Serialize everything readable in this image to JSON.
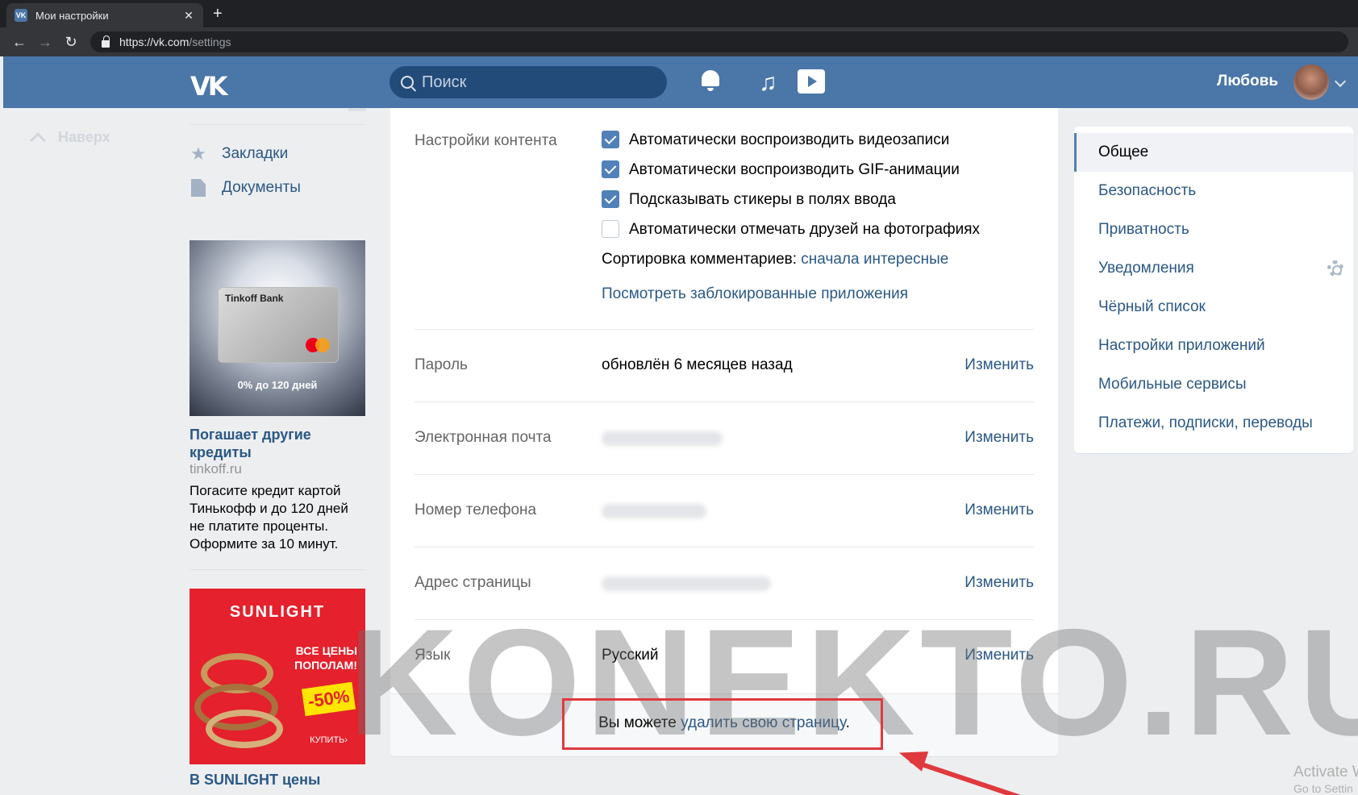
{
  "browser": {
    "tab_title": "Мои настройки",
    "tab_favicon": "VK",
    "url_host": "https://vk.com",
    "url_path": "/settings"
  },
  "header": {
    "logo": "VK",
    "search_placeholder": "Поиск",
    "username": "Любовь"
  },
  "left": {
    "up_button": "Наверх",
    "nav": [
      {
        "label": "Закладки",
        "icon": "star-icon"
      },
      {
        "label": "Документы",
        "icon": "document-icon"
      }
    ],
    "ads": [
      {
        "image_brand": "Tinkoff Bank",
        "image_caption": "0% до 120 дней",
        "title": "Погашает другие кредиты",
        "domain": "tinkoff.ru",
        "text": "Погасите кредит картой Тинькофф и до 120 дней не платите проценты. Оформите за 10 минут."
      },
      {
        "image_brand": "SUNLIGHT",
        "image_line1": "ВСЕ ЦЕНЫ",
        "image_line2": "ПОПОЛАМ!",
        "image_badge": "-50%",
        "image_buy": "КУПИТЬ›",
        "title": "В SUNLIGHT цены"
      }
    ]
  },
  "settings": {
    "content_label": "Настройки контента",
    "content_options": [
      {
        "label": "Автоматически воспроизводить видеозаписи",
        "checked": true
      },
      {
        "label": "Автоматически воспроизводить GIF-анимации",
        "checked": true
      },
      {
        "label": "Подсказывать стикеры в полях ввода",
        "checked": true
      },
      {
        "label": "Автоматически отмечать друзей на фотографиях",
        "checked": false
      }
    ],
    "sort_label": "Сортировка комментариев:",
    "sort_value": "сначала интересные",
    "blocked_apps_link": "Посмотреть заблокированные приложения",
    "change_label": "Изменить",
    "rows": [
      {
        "label": "Пароль",
        "value": "обновлён 6 месяцев назад"
      },
      {
        "label": "Электронная почта",
        "value": ""
      },
      {
        "label": "Номер телефона",
        "value": ""
      },
      {
        "label": "Адрес страницы",
        "value": ""
      },
      {
        "label": "Язык",
        "value": "Русский"
      }
    ],
    "footer_prefix": "Вы можете ",
    "footer_link": "удалить свою страницу",
    "footer_suffix": "."
  },
  "right_menu": {
    "items": [
      {
        "label": "Общее",
        "active": true
      },
      {
        "label": "Безопасность"
      },
      {
        "label": "Приватность"
      },
      {
        "label": "Уведомления"
      },
      {
        "label": "Чёрный список"
      },
      {
        "label": "Настройки приложений"
      },
      {
        "label": "Мобильные сервисы"
      },
      {
        "label": "Платежи, подписки, переводы"
      }
    ]
  },
  "overlays": {
    "watermark": "KONEKTO.RU",
    "activate_line1": "Activate W",
    "activate_line2": "Go to Settin"
  },
  "colors": {
    "header": "#4a76a8",
    "link": "#2a5885",
    "checkbox": "#5181b8",
    "annotation": "#e0393e"
  }
}
